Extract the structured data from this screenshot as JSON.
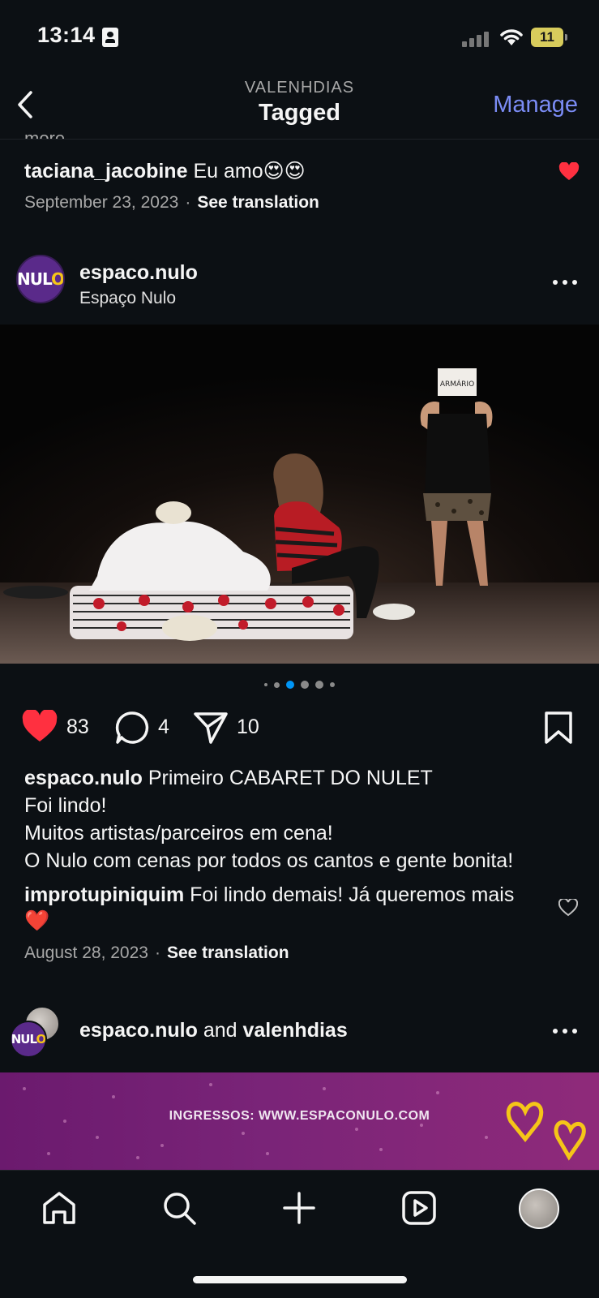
{
  "status_bar": {
    "time": "13:14",
    "battery": "11"
  },
  "header": {
    "username": "VALENHDIAS",
    "title": "Tagged",
    "manage_label": "Manage"
  },
  "prev_comment": {
    "more_fragment": "more",
    "username": "taciana_jacobine",
    "text": "Eu amo😍😍",
    "date": "September 23, 2023",
    "separator": "·",
    "see_translation": "See translation",
    "liked": true
  },
  "post": {
    "avatar_logo": "NUL",
    "avatar_logo_accent": "O",
    "username": "espaco.nulo",
    "subtitle": "Espaço Nulo",
    "photo_prop_label": "ARMÁRIO",
    "carousel": {
      "count": 6,
      "active_index": 2
    },
    "likes": "83",
    "comments": "4",
    "shares": "10",
    "caption_user": "espaco.nulo",
    "caption_first": "Primeiro CABARET DO NULET",
    "caption_lines": [
      "Foi lindo!",
      "Muitos artistas/parceiros em cena!",
      "O Nulo com cenas por todos os cantos e gente bonita!"
    ],
    "comment_user": "improtupiniquim",
    "comment_text": "Foi lindo demais! Já queremos mais ❤️",
    "date": "August 28, 2023",
    "separator": "·",
    "see_translation": "See translation"
  },
  "next_post": {
    "user1": "espaco.nulo",
    "and": "and",
    "user2": "valenhdias",
    "banner_text": "INGRESSOS: WWW.ESPACONULO.COM"
  },
  "colors": {
    "accent": "#7b8cf5",
    "like": "#ff3040",
    "carousel_active": "#0095f6",
    "background": "#0c1014"
  },
  "tabbar": {
    "icons": [
      "home-icon",
      "search-icon",
      "create-icon",
      "reels-icon",
      "profile-avatar"
    ]
  }
}
